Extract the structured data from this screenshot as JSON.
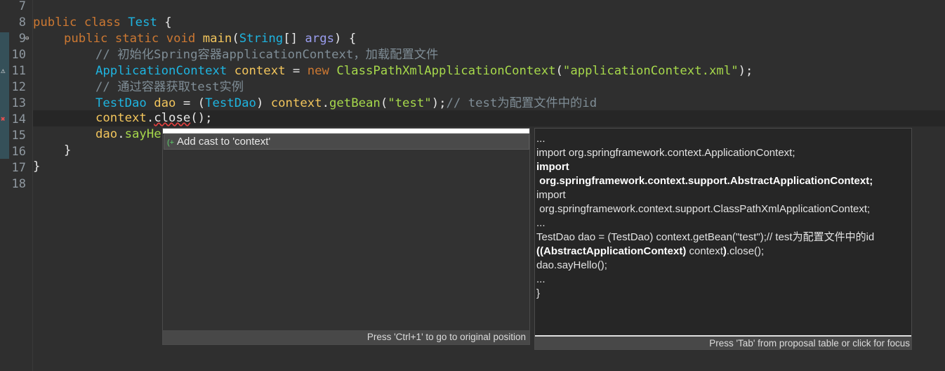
{
  "line_numbers": [
    "7",
    "8",
    "9",
    "10",
    "11",
    "12",
    "13",
    "14",
    "15",
    "16",
    "17",
    "18"
  ],
  "code": {
    "l8": {
      "kw1": "public",
      "kw2": "class",
      "name": "Test",
      "rest": " {"
    },
    "l9": {
      "kw1": "public",
      "kw2": "static",
      "kw3": "void",
      "fn": "main",
      "p1": "(",
      "type": "String",
      "p2": "[] ",
      "param": "args",
      "p3": ") {"
    },
    "l10": {
      "comment": "// 初始化Spring容器applicationContext，加载配置文件"
    },
    "l11": {
      "type": "ApplicationContext",
      "var": "context",
      "eq": " = ",
      "kw": "new",
      "cls": "ClassPathXmlApplicationContext",
      "p1": "(",
      "str": "\"applicationContext.xml\"",
      "p2": ");"
    },
    "l12": {
      "comment": "// 通过容器获取test实例"
    },
    "l13": {
      "type": "TestDao",
      "var": "dao",
      "eq": " = (",
      "cast": "TestDao",
      "p1": ") ",
      "obj": "context",
      "dot": ".",
      "fn": "getBean",
      "p2": "(",
      "str": "\"test\"",
      "p3": ");",
      "comment": "// test为配置文件中的id"
    },
    "l14": {
      "obj": "context",
      "dot": ".",
      "fn": "close",
      "p": "();"
    },
    "l15": {
      "obj": "dao",
      "dot": ".",
      "fn": "sayHe"
    },
    "l16": {
      "text": "}"
    },
    "l17": {
      "text": "}"
    }
  },
  "quickfix": {
    "item_label": "Add cast to 'context'",
    "footer": "Press 'Ctrl+1' to go to original position"
  },
  "preview": {
    "lines": [
      {
        "text": "...",
        "bold": false
      },
      {
        "text": "import org.springframework.context.ApplicationContext;",
        "bold": false
      },
      {
        "text": "import",
        "bold": true
      },
      {
        "text": " org.springframework.context.support.AbstractApplicationContext;",
        "bold": true
      },
      {
        "text": "import",
        "bold": false
      },
      {
        "text": " org.springframework.context.support.ClassPathXmlApplicationContext;",
        "bold": false
      },
      {
        "text": "...",
        "bold": false
      },
      {
        "text": "TestDao dao = (TestDao) context.getBean(\"test\");// test为配置文件中的id",
        "bold": false
      }
    ],
    "cast_bold_a": "((AbstractApplicationContext)",
    "cast_mid": " context",
    "cast_bold_b": ")",
    "cast_tail": ".close();",
    "after": [
      "dao.sayHello();",
      "...",
      "}"
    ],
    "footer": "Press 'Tab' from proposal table or click for focus"
  }
}
